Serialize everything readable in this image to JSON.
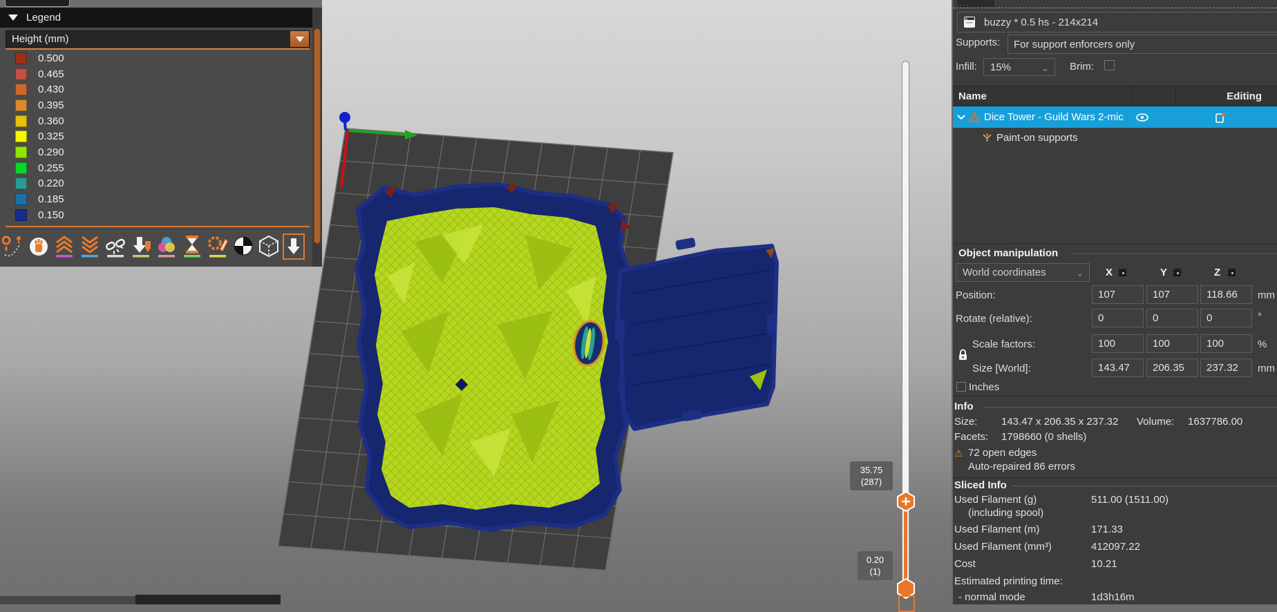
{
  "left_panel": {
    "legend_title": "Legend",
    "height_dropdown_label": "Height (mm)",
    "legend_items": [
      {
        "value": "0.500",
        "color": "#9d2f1b"
      },
      {
        "value": "0.465",
        "color": "#c05144"
      },
      {
        "value": "0.430",
        "color": "#c96b31"
      },
      {
        "value": "0.395",
        "color": "#d9892c"
      },
      {
        "value": "0.360",
        "color": "#e3c10c"
      },
      {
        "value": "0.325",
        "color": "#f5f500"
      },
      {
        "value": "0.290",
        "color": "#8fe600"
      },
      {
        "value": "0.255",
        "color": "#0bd62a"
      },
      {
        "value": "0.220",
        "color": "#2d9b94"
      },
      {
        "value": "0.185",
        "color": "#1e6fa5"
      },
      {
        "value": "0.150",
        "color": "#172c8c"
      }
    ],
    "toolbar_icons": [
      "travel",
      "wipe",
      "retractions",
      "deretractions",
      "seams",
      "tool-changes",
      "color-changes",
      "pause-prints",
      "custom-gcodes",
      "center-of-gravity",
      "shells",
      "collapse-legend"
    ]
  },
  "layer_slider": {
    "upper_tooltip": {
      "line1": "35.75",
      "line2": "(287)"
    },
    "lower_tooltip": {
      "line1": "0.20",
      "line2": "(1)"
    }
  },
  "right_panel": {
    "printer_name": "buzzy * 0.5 hs - 214x214",
    "supports_label": "Supports:",
    "supports_value": "For support enforcers only",
    "infill_label": "Infill:",
    "infill_value": "15%",
    "brim_label": "Brim:",
    "list_columns": {
      "name": "Name",
      "editing": "Editing"
    },
    "object_name": "Dice Tower - Guild Wars 2-mic",
    "paint_on_supports": "Paint-on supports",
    "manipulation": {
      "title": "Object manipulation",
      "coordinates_value": "World coordinates",
      "axis_headers": [
        "X",
        "Y",
        "Z"
      ],
      "rows": [
        {
          "label": "Position:",
          "x": "107",
          "y": "107",
          "z": "118.66",
          "unit": "mm"
        },
        {
          "label": "Rotate (relative):",
          "x": "0",
          "y": "0",
          "z": "0",
          "unit": "°"
        },
        {
          "label": "Scale factors:",
          "x": "100",
          "y": "100",
          "z": "100",
          "unit": "%"
        },
        {
          "label": "Size [World]:",
          "x": "143.47",
          "y": "206.35",
          "z": "237.32",
          "unit": "mm"
        }
      ],
      "inches_label": "Inches"
    },
    "info": {
      "title": "Info",
      "size_label": "Size:",
      "size_value": "143.47 x 206.35 x 237.32",
      "volume_label": "Volume:",
      "volume_value": "1637786.00",
      "facets_label": "Facets:",
      "facets_value": "1798660 (0 shells)",
      "open_edges": "72 open edges",
      "auto_repaired": "Auto-repaired 86 errors"
    },
    "sliced_info": {
      "title": "Sliced Info",
      "rows": [
        {
          "label": "Used Filament (g)",
          "value": "511.00 (1511.00)"
        },
        {
          "label": "(including spool)",
          "value": ""
        },
        {
          "label": "Used Filament (m)",
          "value": "171.33"
        },
        {
          "label": "Used Filament (mm³)",
          "value": "412097.22"
        },
        {
          "label": "Cost",
          "value": "10.21"
        },
        {
          "label": "Estimated printing time:",
          "value": ""
        },
        {
          "label": "- normal mode",
          "value": "1d3h16m"
        }
      ]
    }
  },
  "colors": {
    "accent_orange": "#e8762b",
    "selection_blue": "#189fd9",
    "bed_gray": "#3e3e3e",
    "model_blue": "#16266f",
    "model_green": "#b6d71f"
  }
}
